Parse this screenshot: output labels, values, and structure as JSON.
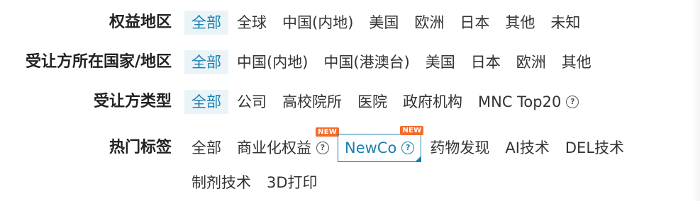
{
  "filters": [
    {
      "label": "权益地区",
      "options": [
        {
          "label": "全部",
          "active": true
        },
        {
          "label": "全球"
        },
        {
          "label": "中国(内地)"
        },
        {
          "label": "美国"
        },
        {
          "label": "欧洲"
        },
        {
          "label": "日本"
        },
        {
          "label": "其他"
        },
        {
          "label": "未知"
        }
      ]
    },
    {
      "label": "受让方所在国家/地区",
      "options": [
        {
          "label": "全部",
          "active": true
        },
        {
          "label": "中国(内地)"
        },
        {
          "label": "中国(港澳台)"
        },
        {
          "label": "美国"
        },
        {
          "label": "日本"
        },
        {
          "label": "欧洲"
        },
        {
          "label": "其他"
        }
      ]
    },
    {
      "label": "受让方类型",
      "options": [
        {
          "label": "全部",
          "active": true
        },
        {
          "label": "公司"
        },
        {
          "label": "高校院所"
        },
        {
          "label": "医院"
        },
        {
          "label": "政府机构"
        },
        {
          "label": "MNC Top20",
          "help": true
        }
      ]
    },
    {
      "label": "热门标签",
      "options": [
        {
          "label": "全部"
        },
        {
          "label": "商业化权益",
          "help": true,
          "badge": "NEW"
        },
        {
          "label": "NewCo",
          "help": true,
          "badge": "NEW",
          "boxed": true
        },
        {
          "label": "药物发现"
        },
        {
          "label": "AI技术"
        },
        {
          "label": "DEL技术"
        },
        {
          "label": "制剂技术"
        },
        {
          "label": "3D打印"
        }
      ]
    }
  ],
  "colors": {
    "accent": "#1a7fb0",
    "active_bg": "#eaf4f8",
    "badge": "#f36c2c",
    "text": "#333333"
  },
  "icons": {
    "help": "question-circle-icon"
  }
}
